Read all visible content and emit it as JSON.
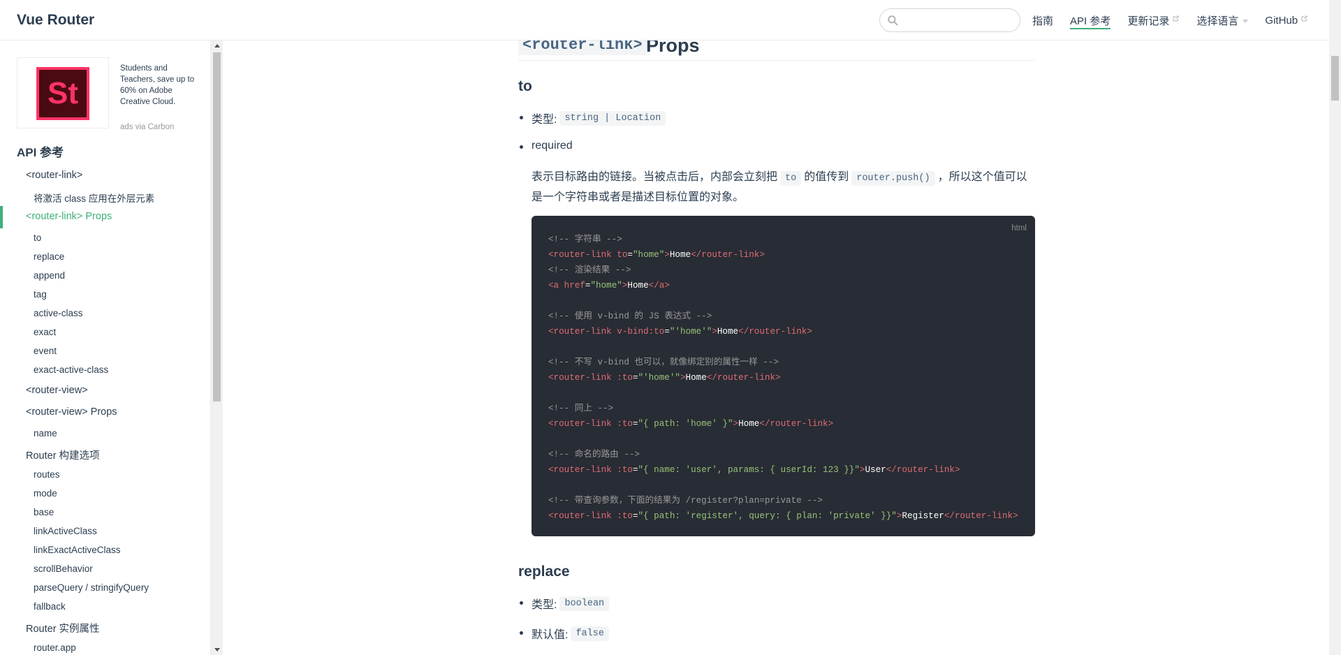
{
  "navbar": {
    "site_name": "Vue Router",
    "search_placeholder": "",
    "links": [
      {
        "label": "指南"
      },
      {
        "label": "API 参考"
      },
      {
        "label": "更新记录"
      },
      {
        "label": "选择语言"
      },
      {
        "label": "GitHub"
      }
    ]
  },
  "ad": {
    "logo_text": "St",
    "text": "Students and Teachers, save up to 60% on Adobe Creative Cloud.",
    "via": "ads via Carbon"
  },
  "sidebar": {
    "heading": "API 参考",
    "items": [
      {
        "label": "<router-link>",
        "level": 1
      },
      {
        "label": "将激活 class 应用在外层元素",
        "level": 2
      },
      {
        "label": "<router-link> Props",
        "level": 1,
        "active": true
      },
      {
        "label": "to",
        "level": 2
      },
      {
        "label": "replace",
        "level": 2
      },
      {
        "label": "append",
        "level": 2
      },
      {
        "label": "tag",
        "level": 2
      },
      {
        "label": "active-class",
        "level": 2
      },
      {
        "label": "exact",
        "level": 2
      },
      {
        "label": "event",
        "level": 2
      },
      {
        "label": "exact-active-class",
        "level": 2
      },
      {
        "label": "<router-view>",
        "level": 1
      },
      {
        "label": "<router-view> Props",
        "level": 1
      },
      {
        "label": "name",
        "level": 2
      },
      {
        "label": "Router 构建选项",
        "level": 1
      },
      {
        "label": "routes",
        "level": 2
      },
      {
        "label": "mode",
        "level": 2
      },
      {
        "label": "base",
        "level": 2
      },
      {
        "label": "linkActiveClass",
        "level": 2
      },
      {
        "label": "linkExactActiveClass",
        "level": 2
      },
      {
        "label": "scrollBehavior",
        "level": 2
      },
      {
        "label": "parseQuery / stringifyQuery",
        "level": 2
      },
      {
        "label": "fallback",
        "level": 2
      },
      {
        "label": "Router 实例属性",
        "level": 1
      },
      {
        "label": "router.app",
        "level": 2
      }
    ]
  },
  "content": {
    "h2_code": "<router-link>",
    "h2_text": "Props",
    "to": {
      "heading": "to",
      "type_label": "类型:",
      "type_value": "string | Location",
      "required": "required",
      "para_1": "表示目标路由的链接。当被点击后，内部会立刻把",
      "para_code_1": "to",
      "para_2": "的值传到",
      "para_code_2": "router.push()",
      "para_3": "，所以这个值可以是一个字符串或者是描述目标位置的对象。"
    },
    "code": {
      "lang": "html",
      "lines": [
        [
          {
            "c": "cm",
            "t": "<!-- 字符串 -->"
          }
        ],
        [
          {
            "c": "tg",
            "t": "<router-link"
          },
          {
            "c": "at",
            "t": " to"
          },
          {
            "c": "pl",
            "t": "="
          },
          {
            "c": "st",
            "t": "\"home\""
          },
          {
            "c": "tg",
            "t": ">"
          },
          {
            "c": "pl",
            "t": "Home"
          },
          {
            "c": "tg",
            "t": "</router-link>"
          }
        ],
        [
          {
            "c": "cm",
            "t": "<!-- 渲染结果 -->"
          }
        ],
        [
          {
            "c": "tg",
            "t": "<a"
          },
          {
            "c": "at",
            "t": " href"
          },
          {
            "c": "pl",
            "t": "="
          },
          {
            "c": "st",
            "t": "\"home\""
          },
          {
            "c": "tg",
            "t": ">"
          },
          {
            "c": "pl",
            "t": "Home"
          },
          {
            "c": "tg",
            "t": "</a>"
          }
        ],
        [],
        [
          {
            "c": "cm",
            "t": "<!-- 使用 v-bind 的 JS 表达式 -->"
          }
        ],
        [
          {
            "c": "tg",
            "t": "<router-link"
          },
          {
            "c": "at",
            "t": " v-bind:to"
          },
          {
            "c": "pl",
            "t": "="
          },
          {
            "c": "st",
            "t": "\"'home'\""
          },
          {
            "c": "tg",
            "t": ">"
          },
          {
            "c": "pl",
            "t": "Home"
          },
          {
            "c": "tg",
            "t": "</router-link>"
          }
        ],
        [],
        [
          {
            "c": "cm",
            "t": "<!-- 不写 v-bind 也可以，就像绑定别的属性一样 -->"
          }
        ],
        [
          {
            "c": "tg",
            "t": "<router-link"
          },
          {
            "c": "at",
            "t": " :to"
          },
          {
            "c": "pl",
            "t": "="
          },
          {
            "c": "st",
            "t": "\"'home'\""
          },
          {
            "c": "tg",
            "t": ">"
          },
          {
            "c": "pl",
            "t": "Home"
          },
          {
            "c": "tg",
            "t": "</router-link>"
          }
        ],
        [],
        [
          {
            "c": "cm",
            "t": "<!-- 同上 -->"
          }
        ],
        [
          {
            "c": "tg",
            "t": "<router-link"
          },
          {
            "c": "at",
            "t": " :to"
          },
          {
            "c": "pl",
            "t": "="
          },
          {
            "c": "st",
            "t": "\"{ path: 'home' }\""
          },
          {
            "c": "tg",
            "t": ">"
          },
          {
            "c": "pl",
            "t": "Home"
          },
          {
            "c": "tg",
            "t": "</router-link>"
          }
        ],
        [],
        [
          {
            "c": "cm",
            "t": "<!-- 命名的路由 -->"
          }
        ],
        [
          {
            "c": "tg",
            "t": "<router-link"
          },
          {
            "c": "at",
            "t": " :to"
          },
          {
            "c": "pl",
            "t": "="
          },
          {
            "c": "st",
            "t": "\"{ name: 'user', params: { userId: 123 }}\""
          },
          {
            "c": "tg",
            "t": ">"
          },
          {
            "c": "pl",
            "t": "User"
          },
          {
            "c": "tg",
            "t": "</router-link>"
          }
        ],
        [],
        [
          {
            "c": "cm",
            "t": "<!-- 带查询参数，下面的结果为 /register?plan=private -->"
          }
        ],
        [
          {
            "c": "tg",
            "t": "<router-link"
          },
          {
            "c": "at",
            "t": " :to"
          },
          {
            "c": "pl",
            "t": "="
          },
          {
            "c": "st",
            "t": "\"{ path: 'register', query: { plan: 'private' }}\""
          },
          {
            "c": "tg",
            "t": ">"
          },
          {
            "c": "pl",
            "t": "Register"
          },
          {
            "c": "tg",
            "t": "</router-link>"
          }
        ]
      ]
    },
    "replace": {
      "heading": "replace",
      "type_label": "类型:",
      "type_value": "boolean",
      "default_label": "默认值:",
      "default_value": "false"
    }
  },
  "colors": {
    "accent": "#3eaf7c",
    "text": "#2c3e50",
    "code_bg": "#282c34"
  }
}
